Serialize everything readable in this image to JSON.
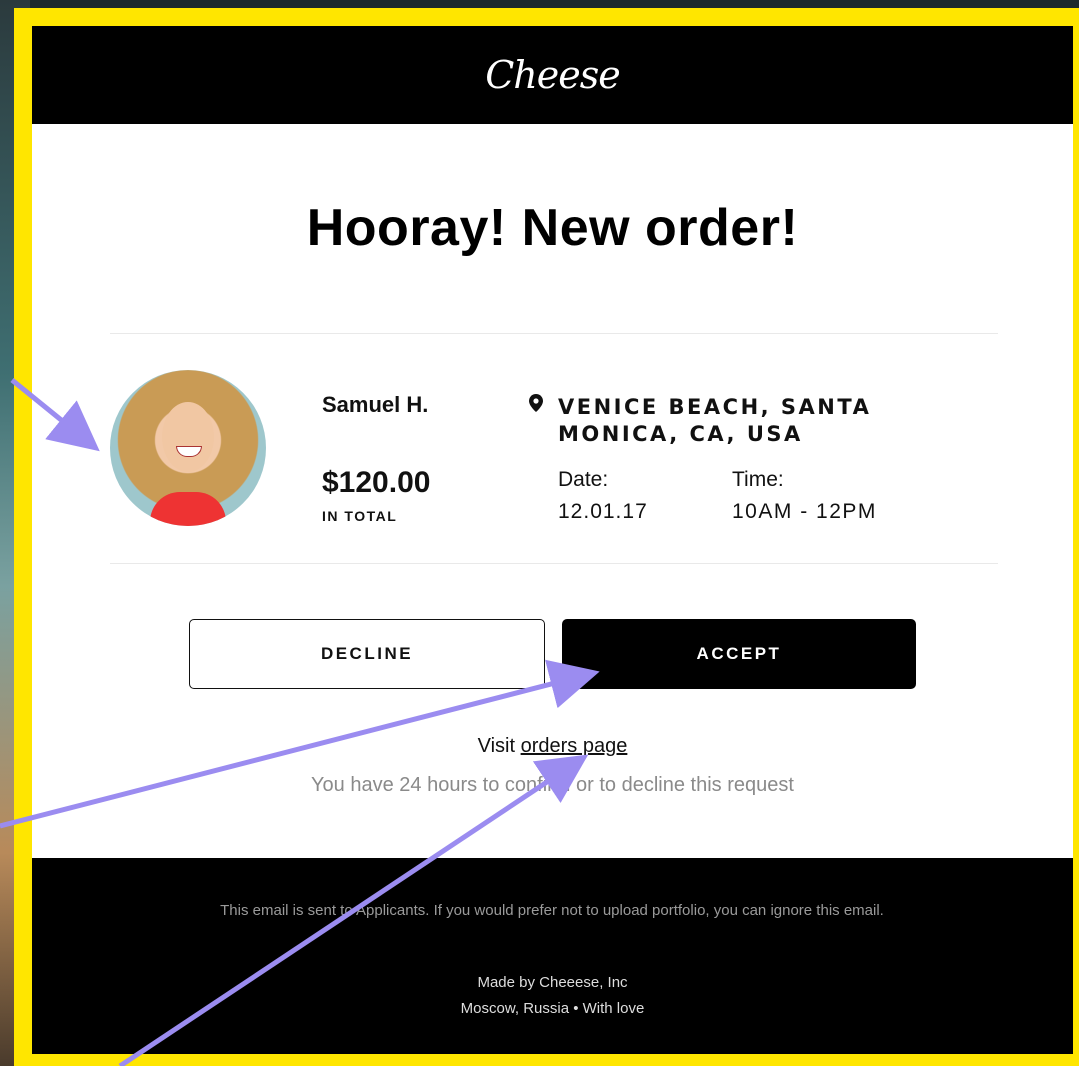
{
  "brand": {
    "logo_text": "Cheese"
  },
  "headline": "Hooray! New order!",
  "order": {
    "customer_name": "Samuel H.",
    "price": "$120.00",
    "price_caption": "IN TOTAL",
    "location": "VENICE BEACH, SANTA MONICA, CA, USA",
    "date_label": "Date:",
    "date_value": "12.01.17",
    "time_label": "Time:",
    "time_value": "10AM - 12PM"
  },
  "actions": {
    "decline_label": "DECLINE",
    "accept_label": "ACCEPT"
  },
  "links": {
    "visit_prefix": "Visit ",
    "orders_link_text": "orders page"
  },
  "note": "You have 24 hours to confirm or to decline this request",
  "footer": {
    "disclaimer": "This email is sent to Applicants. If you would prefer not to upload portfolio, you can ignore this email.",
    "made_by": "Made by Cheeese, Inc",
    "location_line": "Moscow, Russia  • With love"
  },
  "colors": {
    "frame": "#ffe600",
    "header_bg": "#000000",
    "accent_arrow": "#9b8cf0"
  },
  "icons": {
    "location": "map-pin-icon"
  }
}
